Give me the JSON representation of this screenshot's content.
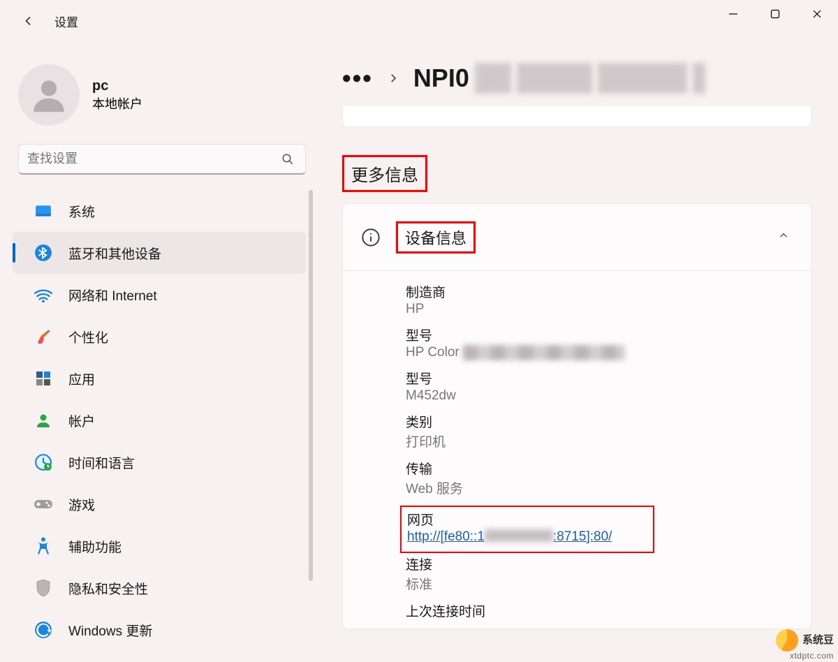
{
  "window": {
    "title": "设置"
  },
  "profile": {
    "name": "pc",
    "account_type": "本地帐户"
  },
  "search": {
    "placeholder": "查找设置"
  },
  "nav": [
    {
      "id": "system",
      "label": "系统"
    },
    {
      "id": "bluetooth",
      "label": "蓝牙和其他设备",
      "active": true
    },
    {
      "id": "network",
      "label": "网络和 Internet"
    },
    {
      "id": "personalization",
      "label": "个性化"
    },
    {
      "id": "apps",
      "label": "应用"
    },
    {
      "id": "accounts",
      "label": "帐户"
    },
    {
      "id": "timelang",
      "label": "时间和语言"
    },
    {
      "id": "gaming",
      "label": "游戏"
    },
    {
      "id": "accessibility",
      "label": "辅助功能"
    },
    {
      "id": "privacy",
      "label": "隐私和安全性"
    },
    {
      "id": "update",
      "label": "Windows 更新"
    }
  ],
  "breadcrumb": {
    "ellipsis": "•••",
    "device_prefix": "NPI0"
  },
  "section": {
    "title": "更多信息",
    "card_title": "设备信息"
  },
  "device": {
    "manufacturer": {
      "label": "制造商",
      "value": "HP"
    },
    "model1": {
      "label": "型号",
      "value_prefix": "HP Color"
    },
    "model2": {
      "label": "型号",
      "value": "M452dw"
    },
    "category": {
      "label": "类别",
      "value": "打印机"
    },
    "transport": {
      "label": "传输",
      "value": "Web 服务"
    },
    "webpage": {
      "label": "网页",
      "value_prefix": "http://[fe80::1",
      "value_suffix": ":8715]:80/"
    },
    "connection": {
      "label": "连接",
      "value": "标准"
    },
    "last_connected": {
      "label": "上次连接时间"
    }
  },
  "watermark": {
    "name": "系统豆",
    "url": "xtdptc.com"
  }
}
